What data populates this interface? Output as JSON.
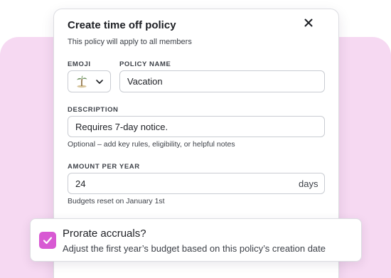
{
  "modal": {
    "title": "Create time off policy",
    "subtitle": "This policy will apply to all members",
    "close_icon": "close-icon",
    "emoji": {
      "label": "EMOJI",
      "selected": "🏝",
      "icon": "palm-tree-icon"
    },
    "policy_name": {
      "label": "POLICY NAME",
      "value": "Vacation"
    },
    "description": {
      "label": "DESCRIPTION",
      "value": "Requires 7-day notice.",
      "helper": "Optional – add key rules, eligibility, or helpful notes"
    },
    "amount": {
      "label": "AMOUNT PER YEAR",
      "value": "24",
      "unit": "days",
      "helper": "Budgets reset on January 1st"
    }
  },
  "prorate": {
    "checked": true,
    "title": "Prorate accruals?",
    "description": "Adjust the first year’s budget based on this policy’s creation date"
  },
  "colors": {
    "backdrop": "#f6d9f2",
    "accent": "#d85ad3"
  }
}
